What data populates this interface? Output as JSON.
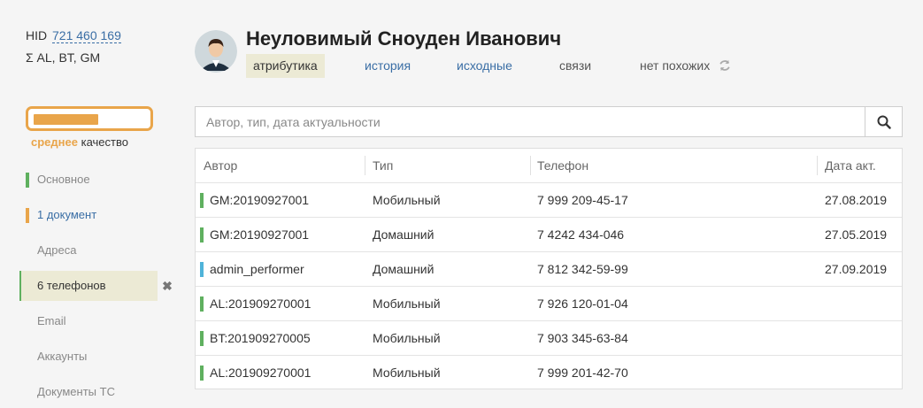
{
  "header": {
    "hid_label": "HID",
    "hid_value": "721 460 169",
    "sources": "Σ AL, BT, GM",
    "person_name": "Неуловимый Сноуден Иванович",
    "tabs": [
      "атрибутика",
      "история",
      "исходные",
      "связи",
      "нет похожих"
    ]
  },
  "quality": {
    "level": "среднее",
    "label": "качество",
    "fill_fraction": 0.55,
    "color": "#e9a54a"
  },
  "sidebar": {
    "items": [
      {
        "label": "Основное",
        "bar_color": "#5fb05f"
      },
      {
        "label": "1 документ",
        "bar_color": "#e9a54a"
      },
      {
        "label": "Адреса",
        "bar_color": ""
      },
      {
        "label": "6 телефонов",
        "bar_color": "#5fb05f"
      },
      {
        "label": "Email",
        "bar_color": ""
      },
      {
        "label": "Аккаунты",
        "bar_color": ""
      },
      {
        "label": "Документы ТС",
        "bar_color": ""
      }
    ]
  },
  "search": {
    "placeholder": "Автор, тип, дата актуальности"
  },
  "table": {
    "columns": [
      "Автор",
      "Тип",
      "Телефон",
      "Дата акт."
    ],
    "rows": [
      {
        "author": "GM:20190927001",
        "type": "Мобильный",
        "phone": "7 999 209-45-17",
        "date": "27.08.2019",
        "bar_color": "#5fb05f"
      },
      {
        "author": "GM:20190927001",
        "type": "Домашний",
        "phone": "7 4242 434-046",
        "date": "27.05.2019",
        "bar_color": "#5fb05f"
      },
      {
        "author": "admin_performer",
        "type": "Домашний",
        "phone": "7 812 342-59-99",
        "date": "27.09.2019",
        "bar_color": "#4fb3d9"
      },
      {
        "author": "AL:201909270001",
        "type": "Мобильный",
        "phone": "7 926 120-01-04",
        "date": "",
        "bar_color": "#5fb05f"
      },
      {
        "author": "BT:201909270005",
        "type": "Мобильный",
        "phone": "7 903 345-63-84",
        "date": "",
        "bar_color": "#5fb05f"
      },
      {
        "author": "AL:201909270001",
        "type": "Мобильный",
        "phone": "7 999 201-42-70",
        "date": "",
        "bar_color": "#5fb05f"
      }
    ]
  }
}
